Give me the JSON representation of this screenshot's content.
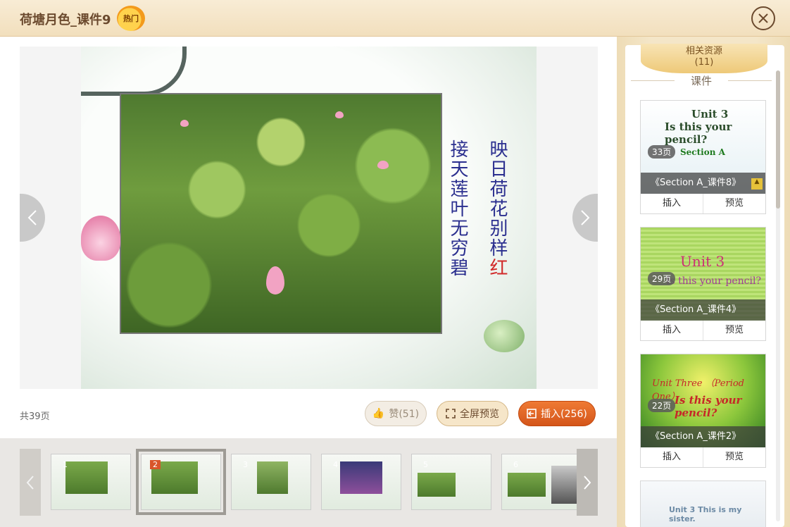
{
  "header": {
    "title": "荷塘月色_课件9",
    "hot_badge": "热门",
    "close_icon": "close-icon"
  },
  "slide": {
    "poem_right": "映日荷花别样",
    "poem_right_red": "红",
    "poem_left": "接天莲叶无穷碧",
    "prev_icon": "chevron-left-icon",
    "next_icon": "chevron-right-icon"
  },
  "footer": {
    "page_total_prefix": "共",
    "page_total_value": "39",
    "page_total_suffix": "页",
    "like_label": "赞(51)",
    "fullscreen_label": "全屏预览",
    "insert_label": "插入(256)"
  },
  "thumbnails": {
    "items": [
      {
        "num": "1"
      },
      {
        "num": "2"
      },
      {
        "num": "3"
      },
      {
        "num": "4"
      },
      {
        "num": "5"
      },
      {
        "num": "6"
      }
    ],
    "active_index": 1
  },
  "sidebar": {
    "tab_label": "相关资源",
    "tab_count": "(11)",
    "section_label": "课件",
    "cards": [
      {
        "pages": "33页",
        "caption": "《Section A_课件8》",
        "img_line1": "Unit 3",
        "img_line2": "Is this your pencil?",
        "img_line3": "Section A",
        "insert": "插入",
        "preview": "预览"
      },
      {
        "pages": "29页",
        "caption": "《Section A_课件4》",
        "img_line1": "Unit 3",
        "img_line2": "Is this your pencil?",
        "insert": "插入",
        "preview": "预览"
      },
      {
        "pages": "22页",
        "caption": "《Section A_课件2》",
        "img_line1": "Unit Three （Period One）",
        "img_line2": "Is this your pencil?",
        "insert": "插入",
        "preview": "预览"
      },
      {
        "img_line1": "Unit 3  This is my sister."
      }
    ]
  },
  "colors": {
    "accent_orange": "#d4551a",
    "header_bg": "#f2dfbd",
    "title_brown": "#6b4a2e",
    "poem_blue": "#2b2f8f",
    "poem_red": "#d12a2a"
  }
}
